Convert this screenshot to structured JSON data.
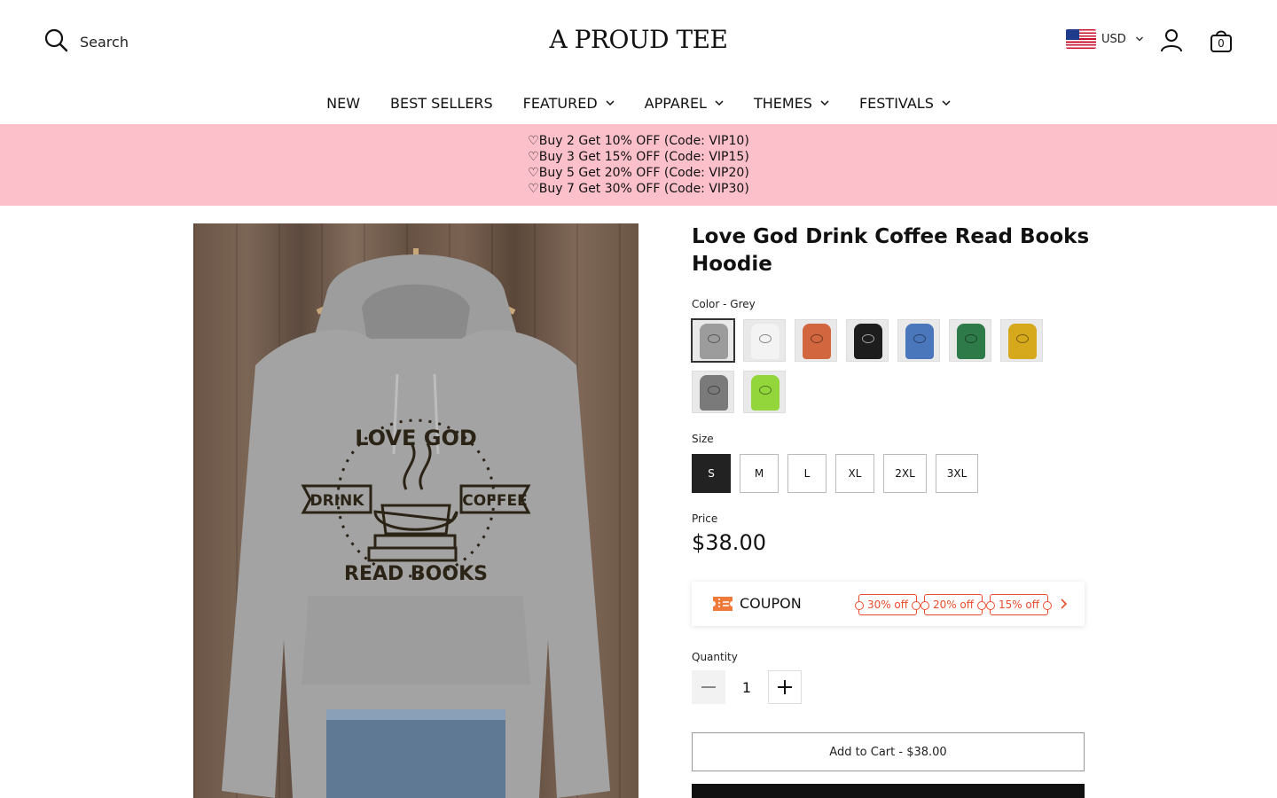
{
  "header": {
    "search_label": "Search",
    "logo": "A PROUD TEE",
    "currency": "USD",
    "cart_count": "0"
  },
  "nav": {
    "items": [
      {
        "label": "NEW",
        "dropdown": false
      },
      {
        "label": "BEST SELLERS",
        "dropdown": false
      },
      {
        "label": "FEATURED",
        "dropdown": true
      },
      {
        "label": "APPAREL",
        "dropdown": true
      },
      {
        "label": "THEMES",
        "dropdown": true
      },
      {
        "label": "FESTIVALS",
        "dropdown": true
      }
    ]
  },
  "promo": {
    "lines": [
      "♡Buy 2 Get 10% OFF (Code: VIP10)",
      "♡Buy 3 Get 15% OFF (Code: VIP15)",
      "♡Buy 5 Get 20% OFF (Code: VIP20)",
      "♡Buy 7 Get 30% OFF (Code: VIP30)"
    ],
    "bg_color": "#fcc0cb"
  },
  "product": {
    "title": "Love God Drink Coffee Read Books Hoodie",
    "image_text": {
      "top": "LOVE GOD",
      "left": "DRINK",
      "right": "COFFEE",
      "bottom": "READ BOOKS"
    },
    "color_label": "Color - Grey",
    "colors": [
      {
        "name": "Grey",
        "hex": "#9c9c9c",
        "selected": true
      },
      {
        "name": "White",
        "hex": "#f3f3f3",
        "selected": false
      },
      {
        "name": "Orange",
        "hex": "#d2673f",
        "selected": false
      },
      {
        "name": "Black",
        "hex": "#1d1d1d",
        "selected": false
      },
      {
        "name": "Blue",
        "hex": "#4a76bb",
        "selected": false
      },
      {
        "name": "Green",
        "hex": "#2e7a48",
        "selected": false
      },
      {
        "name": "Yellow",
        "hex": "#d6a81c",
        "selected": false
      },
      {
        "name": "Dark Grey",
        "hex": "#7a7a7a",
        "selected": false
      },
      {
        "name": "Lime",
        "hex": "#92d63c",
        "selected": false
      }
    ],
    "size_label": "Size",
    "sizes": [
      {
        "label": "S",
        "active": true
      },
      {
        "label": "M",
        "active": false
      },
      {
        "label": "L",
        "active": false
      },
      {
        "label": "XL",
        "active": false
      },
      {
        "label": "2XL",
        "active": false
      },
      {
        "label": "3XL",
        "active": false
      }
    ],
    "price_label": "Price",
    "price": "$38.00",
    "coupon": {
      "label": "COUPON",
      "tags": [
        "30% off",
        "20% off",
        "15% off"
      ],
      "accent": "#e94d2c"
    },
    "quantity_label": "Quantity",
    "quantity": "1",
    "add_to_cart_label": "Add to Cart - $38.00"
  }
}
